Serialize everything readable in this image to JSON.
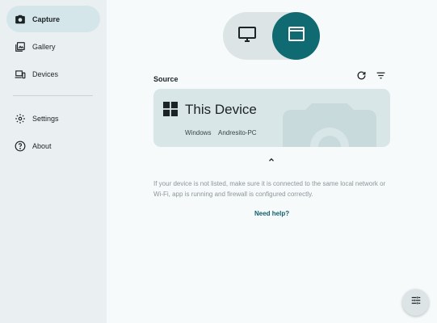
{
  "sidebar": {
    "items": [
      {
        "label": "Capture",
        "icon": "camera-icon",
        "active": true
      },
      {
        "label": "Gallery",
        "icon": "gallery-icon",
        "active": false
      },
      {
        "label": "Devices",
        "icon": "devices-icon",
        "active": false
      },
      {
        "label": "Settings",
        "icon": "gear-icon",
        "active": false
      },
      {
        "label": "About",
        "icon": "help-icon",
        "active": false
      }
    ]
  },
  "mode_toggle": {
    "options": [
      {
        "icon": "monitor-icon",
        "selected": false
      },
      {
        "icon": "window-icon",
        "selected": true
      }
    ]
  },
  "source": {
    "label": "Source",
    "refresh_icon": "refresh-icon",
    "filter_icon": "filter-icon",
    "device": {
      "name": "This Device",
      "os": "Windows",
      "host": "Andresito-PC",
      "logo_icon": "windows-logo-icon"
    }
  },
  "help": {
    "text": "If your device is not listed, make sure it is connected to the same local network or Wi-Fi, app is running and firewall is configured correctly.",
    "link": "Need help?"
  },
  "fab": {
    "icon": "tune-icon"
  },
  "colors": {
    "accent": "#0f6a72",
    "sidebar_bg": "#eaf0f2",
    "active_bg": "#d5e6ea",
    "card_bg": "#d8e6e8",
    "link": "#0f5f6a"
  }
}
